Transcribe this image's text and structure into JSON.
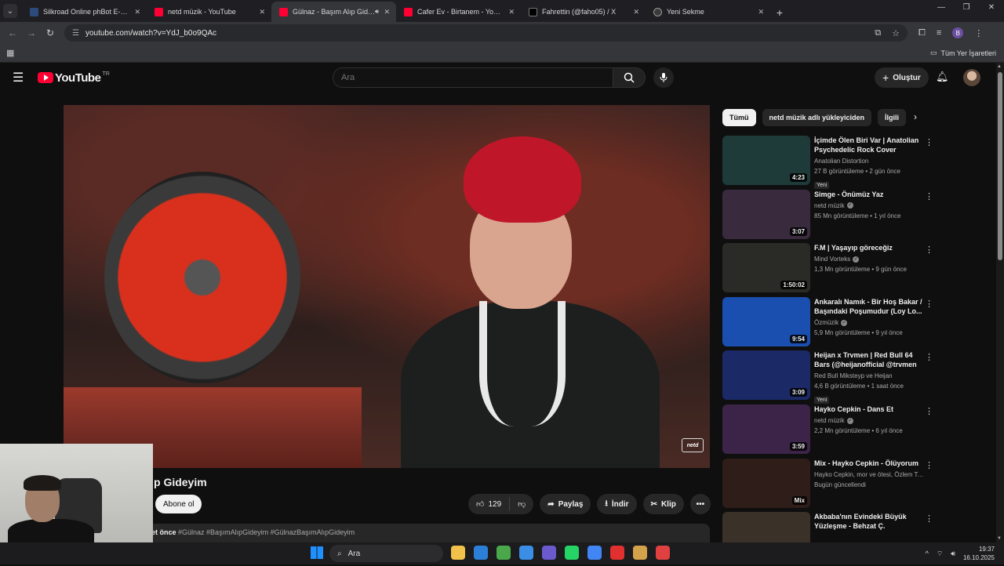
{
  "browser": {
    "tabs": [
      {
        "label": "Silkroad Online phBot E-PİN Sa",
        "favicon": "sro",
        "active": false
      },
      {
        "label": "netd müzik - YouTube",
        "favicon": "yt",
        "active": false
      },
      {
        "label": "Gülnaz - Başım Alıp Gideyim",
        "favicon": "yt",
        "active": true
      },
      {
        "label": "Cafer Ev - Birtanem - YouTube",
        "favicon": "yt",
        "active": false
      },
      {
        "label": "Fahrettin (@faho05) / X",
        "favicon": "x",
        "active": false
      },
      {
        "label": "Yeni Sekme",
        "favicon": "g",
        "active": false
      }
    ],
    "url": "youtube.com/watch?v=YdJ_b0o9QAc",
    "profile_letter": "B",
    "bookmarks_all": "Tüm Yer İşaretleri"
  },
  "youtube": {
    "logo_text": "YouTube",
    "country_code": "TR",
    "search_placeholder": "Ara",
    "create_label": "Oluştur",
    "video": {
      "title_visible": "p Gideyim",
      "subscribe_label": "Abone ol",
      "likes": "129",
      "share_label": "Paylaş",
      "download_label": "İndir",
      "clip_label": "Klip",
      "desc_time": "et önce",
      "desc_tags": "#Gülnaz #BaşımAlıpGideyim #GülnazBaşımAlıpGideyim",
      "watermark": "netd"
    },
    "chips": [
      "Tümü",
      "netd müzik adlı yükleyiciden",
      "İlgili"
    ],
    "recommendations": [
      {
        "title": "İçimde Ölen Biri Var | Anatolian Psychedelic Rock Cover",
        "channel": "Anatolian Distortion",
        "verified": false,
        "stats": "27 B görüntüleme • 2 gün önce",
        "badge": "Yeni",
        "duration": "4:23",
        "thumb": "#1e3b3a"
      },
      {
        "title": "Simge - Önümüz Yaz",
        "channel": "netd müzik",
        "verified": true,
        "stats": "85 Mn görüntüleme • 1 yıl önce",
        "badge": "",
        "duration": "3:07",
        "thumb": "#3a2a3e"
      },
      {
        "title": "F.M | Yaşayıp göreceğiz",
        "channel": "Mind Vorteks",
        "verified": true,
        "stats": "1,3 Mn görüntüleme • 9 gün önce",
        "badge": "",
        "duration": "1:50:02",
        "thumb": "#2a2a26"
      },
      {
        "title": "Ankaralı Namık - Bir Hoş Bakar / Başındaki Poşumudur (Loy Lo...",
        "channel": "Özmüzik",
        "verified": true,
        "stats": "5,9 Mn görüntüleme • 9 yıl önce",
        "badge": "",
        "duration": "9:54",
        "thumb": "#1a4fb0"
      },
      {
        "title": "Heijan x Trvmen | Red Bull 64 Bars (@heijanofficial @trvmen",
        "channel": "Red Bull Miksteyp ve Heijan",
        "verified": false,
        "stats": "4,6 B görüntüleme • 1 saat önce",
        "badge": "Yeni",
        "duration": "3:09",
        "thumb": "#1b2a66"
      },
      {
        "title": "Hayko Cepkin - Dans Et",
        "channel": "netd müzik",
        "verified": true,
        "stats": "2,2 Mn görüntüleme • 6 yıl önce",
        "badge": "",
        "duration": "3:59",
        "thumb": "#3c2348"
      },
      {
        "title": "Mix - Hayko Cepkin - Ölüyorum",
        "channel": "Hayko Cepkin, mor ve ötesi, Özlem Tekin ...",
        "verified": false,
        "stats": "Bugün güncellendi",
        "badge": "",
        "duration": "Mix",
        "thumb": "#2e1d18"
      },
      {
        "title": "Akbaba'nın Evindeki Büyük Yüzleşme - Behzat Ç.",
        "channel": "",
        "verified": false,
        "stats": "",
        "badge": "",
        "duration": "",
        "thumb": "#3a3128"
      }
    ]
  },
  "taskbar": {
    "search_placeholder": "Ara",
    "time": "19:37",
    "date": "16.10.2025",
    "apps": [
      "#f0c24b",
      "#2c7fd6",
      "#4aa84a",
      "#3a8ee6",
      "#6a5acd",
      "#25d366",
      "#4285f4",
      "#e03030",
      "#d4a24a",
      "#e04040"
    ]
  }
}
